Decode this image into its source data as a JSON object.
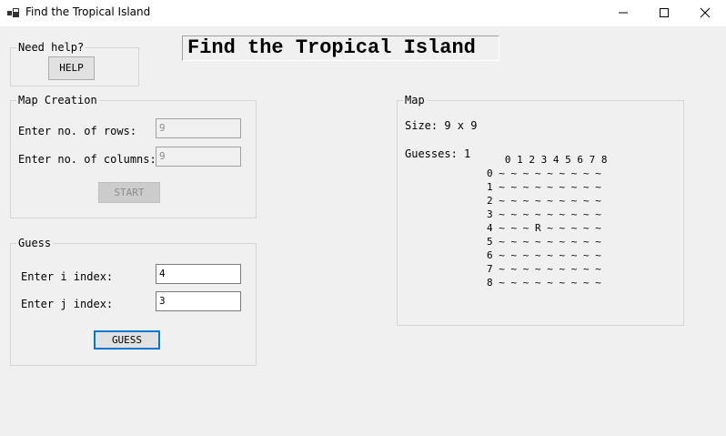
{
  "window": {
    "title": "Find the Tropical Island"
  },
  "heading": "Find the Tropical Island",
  "help_group": {
    "legend": "Need help?",
    "button": "HELP"
  },
  "map_creation": {
    "legend": "Map Creation",
    "rows_label": "Enter no. of rows:",
    "rows_value": "9",
    "cols_label": "Enter no. of columns:",
    "cols_value": "9",
    "start_button": "START"
  },
  "guess_group": {
    "legend": "Guess",
    "i_label": "Enter i index:",
    "i_value": "4",
    "j_label": "Enter j index:",
    "j_value": "3",
    "guess_button": "GUESS"
  },
  "map": {
    "legend": "Map",
    "size": "Size: 9 x 9",
    "guesses": "Guesses: 1",
    "grid": [
      "   0 1 2 3 4 5 6 7 8",
      "0 ~ ~ ~ ~ ~ ~ ~ ~ ~",
      "1 ~ ~ ~ ~ ~ ~ ~ ~ ~",
      "2 ~ ~ ~ ~ ~ ~ ~ ~ ~",
      "3 ~ ~ ~ ~ ~ ~ ~ ~ ~",
      "4 ~ ~ ~ R ~ ~ ~ ~ ~",
      "5 ~ ~ ~ ~ ~ ~ ~ ~ ~",
      "6 ~ ~ ~ ~ ~ ~ ~ ~ ~",
      "7 ~ ~ ~ ~ ~ ~ ~ ~ ~",
      "8 ~ ~ ~ ~ ~ ~ ~ ~ ~"
    ]
  },
  "icons": {
    "app": "app-icon",
    "minimize": "minimize-icon",
    "maximize": "maximize-icon",
    "close": "close-icon"
  }
}
